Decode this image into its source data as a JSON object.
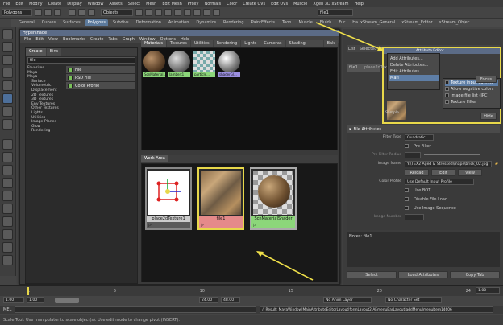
{
  "menubar": [
    "File",
    "Edit",
    "Modify",
    "Create",
    "Display",
    "Window",
    "Assets",
    "Select",
    "Mesh",
    "Edit Mesh",
    "Proxy",
    "Normals",
    "Color",
    "Create UVs",
    "Edit UVs",
    "Muscle",
    "Xgen 3D xStream",
    "Help"
  ],
  "status": {
    "mode": "Polygons",
    "objects": "Objects",
    "search": "file1"
  },
  "shelf_tabs": [
    "General",
    "Curves",
    "Surfaces",
    "Polygons",
    "Subdivs",
    "Deformation",
    "Animation",
    "Dynamics",
    "Rendering",
    "PaintEffects",
    "Toon",
    "Muscle",
    "Fluids",
    "Fur",
    "Hair",
    "nCloth",
    "Custom"
  ],
  "shelf_active": "Polygons",
  "shelf_right": [
    "xStream_General",
    "xStream_Editor",
    "xStream_Objec"
  ],
  "shelf_icons": [
    "Cbp",
    "FT",
    "Hist",
    "Split"
  ],
  "hypershade": {
    "title": "Hypershade",
    "menus": [
      "File",
      "Edit",
      "View",
      "Bookmarks",
      "Create",
      "Tabs",
      "Graph",
      "Window",
      "Options",
      "Help"
    ],
    "left_tabs": [
      "Create",
      "Bins"
    ],
    "search": "file",
    "tree": [
      "Favorites",
      "Maya",
      "Maya",
      "Surface",
      "Volumetric",
      "Displacement",
      "2D Textures",
      "3D Textures",
      "Env Textures",
      "Other Textures",
      "Lights",
      "Utilities",
      "Image Planes",
      "Glow",
      "Rendering"
    ],
    "files": [
      "File",
      "PSD File",
      "Color Profile"
    ],
    "top_tabs": [
      "Materials",
      "Textures",
      "Utilities",
      "Rendering",
      "Lights",
      "Cameras",
      "Shading Groups",
      "Bak"
    ],
    "swatches": [
      {
        "label": "ScnMaterial...",
        "color": "#8cd67a"
      },
      {
        "label": "lambert1",
        "color": "#8cd67a"
      },
      {
        "label": "particle...",
        "color": "#8cd67a"
      },
      {
        "label": "shaderGl...",
        "color": "#9b8fe0"
      }
    ],
    "work_tab": "Work Area",
    "nodes": [
      {
        "label": "place2dTexture1",
        "bar": "#5a5a5a"
      },
      {
        "label": "file1",
        "bar": "#e58a8a"
      },
      {
        "label": "ScnMaterialShader",
        "bar": "#8cd67a"
      }
    ]
  },
  "attr_editor": {
    "title": "Attribute Editor",
    "menus": [
      "List",
      "Selected",
      "Focus",
      "Attributes",
      "Show",
      "Help"
    ],
    "tab_left": "file1",
    "tab_right": "place2dTexture",
    "attr_menu": [
      "Add Attributes...",
      "Delete Attributes...",
      "Edit Attributes...",
      "Mari"
    ],
    "sub_menu": [
      "Texture input gamma",
      "Allow negative colors",
      "Image file list (IPC)",
      "Texture Filter"
    ],
    "sample": "Sample",
    "focus": "Focus",
    "presets": "Presets",
    "show": "Show",
    "hide": "Hide",
    "file_attributes": "File Attributes",
    "filter_type_label": "Filter Type",
    "filter_type": "Quadratic",
    "pre_filter": "Pre Filter",
    "pre_filter_radius": "Pre Filter Radius",
    "image_name_label": "Image Name",
    "image_name": "Y:\\TEX2 Aged & Stressed\\maps\\brick_02.jpg",
    "reload": "Reload",
    "edit": "Edit",
    "view": "View",
    "color_profile_label": "Color Profile",
    "color_profile": "Use Default Input Profile",
    "checks": [
      "Use BOT",
      "Disable File Load",
      "Use Image Sequence"
    ],
    "image_number": "Image Number",
    "notes": "Notes: file1",
    "buttons": [
      "Select",
      "Load Attributes",
      "Copy Tab"
    ]
  },
  "timeline": {
    "ticks": [
      "1",
      "",
      "5",
      "",
      "10",
      "",
      "15",
      "",
      "20",
      "",
      "24"
    ],
    "frame": "1.00"
  },
  "range": {
    "start": "1.00",
    "cur": "1.00",
    "end": "24.00",
    "end2": "48.00",
    "anim": "No Anim Layer",
    "char": "No Character Set"
  },
  "cmd": {
    "label": "MEL",
    "result": "// Result: MayaWindow|MainAttributeEditorLayout|formLayout2|AEmenuBarLayout|addMenu|menuItem14606"
  },
  "help": "Scale Tool: Use manipulator to scale object(s). Use edit mode to change pivot (INSERT)."
}
